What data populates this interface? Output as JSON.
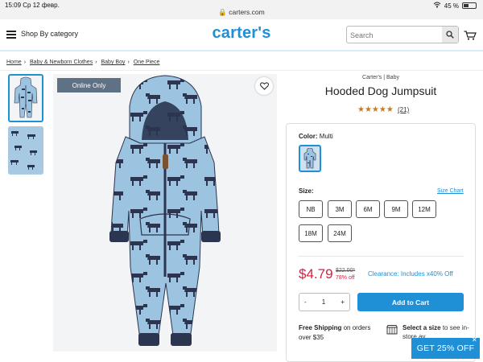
{
  "status_bar": {
    "time": "15:09",
    "date": "Ср 12 февр.",
    "url": "carters.com",
    "battery": "45 %"
  },
  "header": {
    "menu_label": "Shop By category",
    "logo_text": "carter's",
    "search_placeholder": "Search"
  },
  "breadcrumb": [
    "Home",
    "Baby & Newborn Clothes",
    "Baby Boy",
    "One Piece"
  ],
  "gallery": {
    "badge": "Online Only"
  },
  "product": {
    "brand": "Carter's | Baby",
    "title": "Hooded Dog Jumpsuit",
    "stars": "★★★★★",
    "rating": 5,
    "review_count": "(21)"
  },
  "options": {
    "color_label": "Color:",
    "color_value": "Multi",
    "size_label": "Size:",
    "size_chart_label": "Size Chart",
    "sizes": [
      "NB",
      "3M",
      "6M",
      "9M",
      "12M",
      "18M",
      "24M"
    ]
  },
  "pricing": {
    "price": "$4.79",
    "original": "$22.00*",
    "percent_off": "78% off",
    "clearance": "Clearance: Includes x40% Off"
  },
  "purchase": {
    "qty_minus": "-",
    "qty_value": "1",
    "qty_plus": "+",
    "add_to_cart": "Add to Cart"
  },
  "shipping": {
    "free_bold": "Free Shipping",
    "free_rest": "on orders over $35",
    "store_bold": "Select a size",
    "store_rest": "to see in-store av..."
  },
  "promo": {
    "text": "GET 25% OFF",
    "close": "✕"
  },
  "colors": {
    "brand_blue": "#1f8fd6",
    "sale_red": "#d6213f",
    "badge_gray": "#5f7185",
    "star_orange": "#c67b1e",
    "garment_blue": "#9cc3e0",
    "garment_navy": "#2b3550"
  }
}
